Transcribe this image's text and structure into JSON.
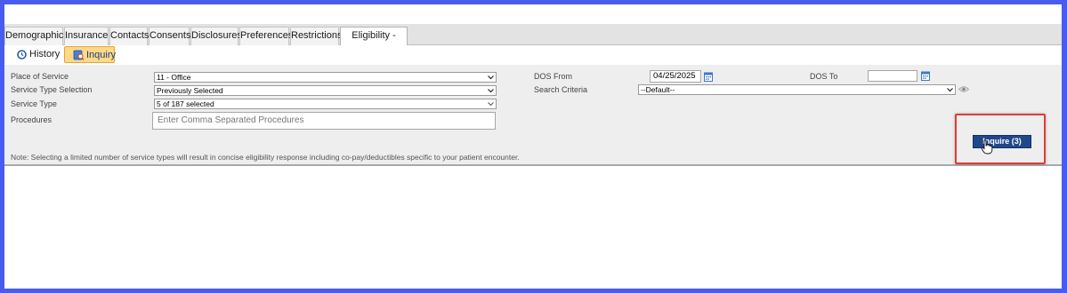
{
  "tabs": [
    {
      "label": "Demographics",
      "active": false
    },
    {
      "label": "Insurance",
      "active": false
    },
    {
      "label": "Contacts",
      "active": false
    },
    {
      "label": "Consents",
      "active": false
    },
    {
      "label": "Disclosures",
      "active": false
    },
    {
      "label": "Preferences",
      "active": false
    },
    {
      "label": "Restrictions",
      "active": false
    },
    {
      "label": "Eligibility - AARP",
      "active": true
    }
  ],
  "subtabs": {
    "history": {
      "label": "History",
      "icon": "clock-icon"
    },
    "inquiry": {
      "label": "Inquiry",
      "icon": "inquiry-icon",
      "active": true
    }
  },
  "form": {
    "place_of_service": {
      "label": "Place of Service",
      "value": "11 - Office"
    },
    "service_type_selection": {
      "label": "Service Type Selection",
      "value": "Previously Selected"
    },
    "service_type": {
      "label": "Service Type",
      "value": "5 of 187 selected"
    },
    "procedures": {
      "label": "Procedures",
      "placeholder": "Enter Comma Separated Procedures"
    },
    "dos_from": {
      "label": "DOS From",
      "value": "04/25/2025"
    },
    "dos_to": {
      "label": "DOS To",
      "value": ""
    },
    "search_criteria": {
      "label": "Search Criteria",
      "value": "--Default--"
    }
  },
  "note": "Note: Selecting a limited number of service types will result in concise eligibility response including co-pay/deductibles specific to your patient encounter.",
  "inquire_button": {
    "label": "Inquire (3)"
  },
  "colors": {
    "frame": "#4a5cf0",
    "button": "#20478a",
    "highlight": "#e03b3b",
    "active_subtab": "#ffd98a"
  }
}
